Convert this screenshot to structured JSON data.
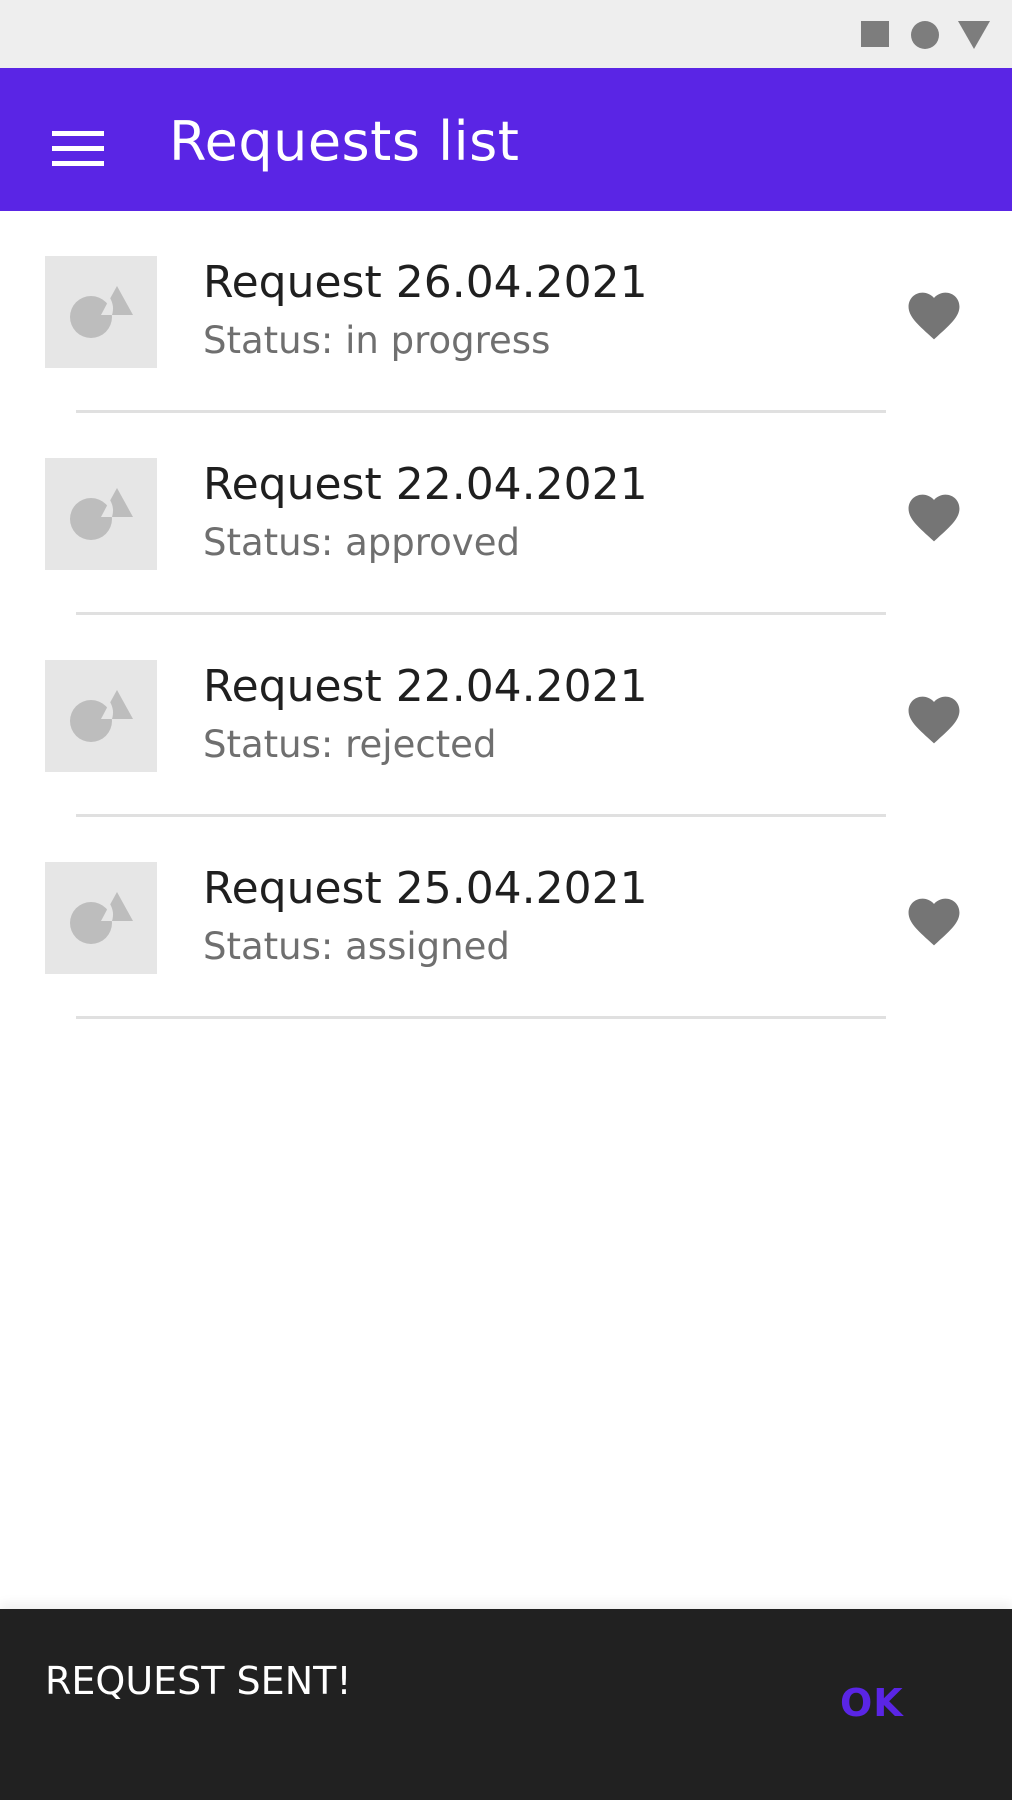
{
  "status_bar": {
    "icons": [
      "square-icon",
      "circle-icon",
      "triangle-icon"
    ]
  },
  "app_bar": {
    "title": "Requests list",
    "menu_icon": "hamburger-menu-icon",
    "background_color": "#5a25e5"
  },
  "requests": [
    {
      "title": "Request 26.04.2021",
      "status": "Status: in progress",
      "thumbnail_icon": "image-placeholder-icon",
      "action_icon": "heart-icon"
    },
    {
      "title": "Request 22.04.2021",
      "status": "Status: approved",
      "thumbnail_icon": "image-placeholder-icon",
      "action_icon": "heart-icon"
    },
    {
      "title": "Request 22.04.2021",
      "status": "Status: rejected",
      "thumbnail_icon": "image-placeholder-icon",
      "action_icon": "heart-icon"
    },
    {
      "title": "Request 25.04.2021",
      "status": "Status: assigned",
      "thumbnail_icon": "image-placeholder-icon",
      "action_icon": "heart-icon"
    }
  ],
  "snackbar": {
    "message": "REQUEST SENT!",
    "action_label": "OK",
    "action_color": "#5a25e5"
  }
}
